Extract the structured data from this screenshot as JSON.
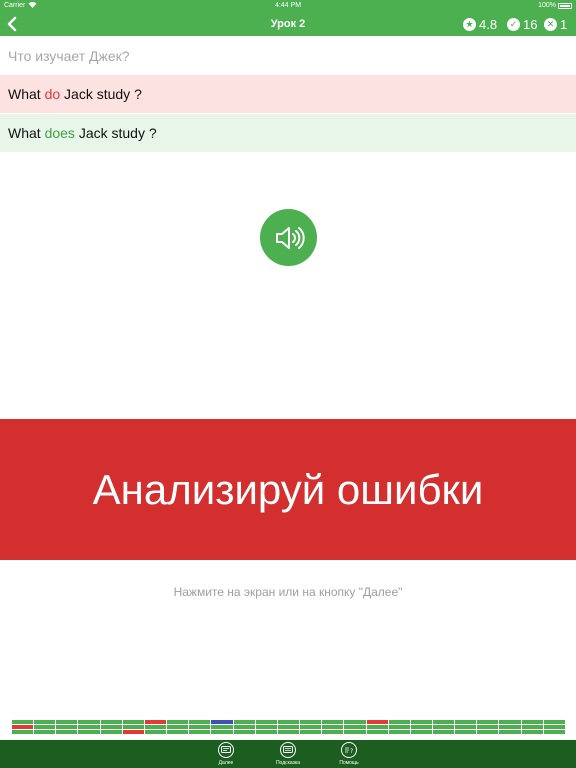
{
  "status_bar": {
    "carrier": "Carrier",
    "time": "4:44 PM",
    "battery": "100%"
  },
  "nav": {
    "title": "Урок 2",
    "rating": "4.8",
    "correct_count": "16",
    "wrong_count": "1",
    "icons": {
      "back": "chevron-left-icon",
      "rating": "star-icon",
      "correct": "check-icon",
      "wrong": "cross-icon"
    }
  },
  "question": {
    "text": "Что изучает Джек?"
  },
  "user_answer": {
    "before": "What ",
    "highlight": "do",
    "after": " Jack study ?"
  },
  "correct_answer": {
    "before": "What ",
    "highlight": "does",
    "after": " Jack study ?"
  },
  "banner": {
    "text": "Анализируй ошибки"
  },
  "hint": {
    "text": "Нажмите на экран или на кнопку \"Далее\""
  },
  "toolbar": {
    "next_label": "Далее",
    "hint_label": "Подсказка",
    "help_label": "Помощь"
  },
  "colors": {
    "primary": "#4caf50",
    "dark_green": "#1b5e20",
    "error": "#d32f2f",
    "error_bg": "#fde2e2",
    "success_bg": "#e8f5e9",
    "progress_wrong": "#e53935",
    "progress_current": "#3f51b5"
  },
  "progress": {
    "segments": [
      [
        "g",
        "r",
        "g"
      ],
      [
        "g",
        "g",
        "g"
      ],
      [
        "g",
        "g",
        "g"
      ],
      [
        "g",
        "g",
        "g"
      ],
      [
        "g",
        "g",
        "g"
      ],
      [
        "g",
        "g",
        "r"
      ],
      [
        "r",
        "g",
        "g"
      ],
      [
        "g",
        "g",
        "g"
      ],
      [
        "g",
        "g",
        "g"
      ],
      [
        "b",
        "g",
        "g"
      ],
      [
        "g",
        "g",
        "g"
      ],
      [
        "g",
        "g",
        "g"
      ],
      [
        "g",
        "g",
        "g"
      ],
      [
        "g",
        "g",
        "g"
      ],
      [
        "g",
        "g",
        "g"
      ],
      [
        "g",
        "g",
        "g"
      ],
      [
        "r",
        "g",
        "g"
      ],
      [
        "g",
        "g",
        "g"
      ],
      [
        "g",
        "g",
        "g"
      ],
      [
        "g",
        "g",
        "g"
      ],
      [
        "g",
        "g",
        "g"
      ],
      [
        "g",
        "g",
        "g"
      ],
      [
        "g",
        "g",
        "g"
      ],
      [
        "g",
        "g",
        "g"
      ],
      [
        "g",
        "g",
        "g"
      ]
    ]
  }
}
